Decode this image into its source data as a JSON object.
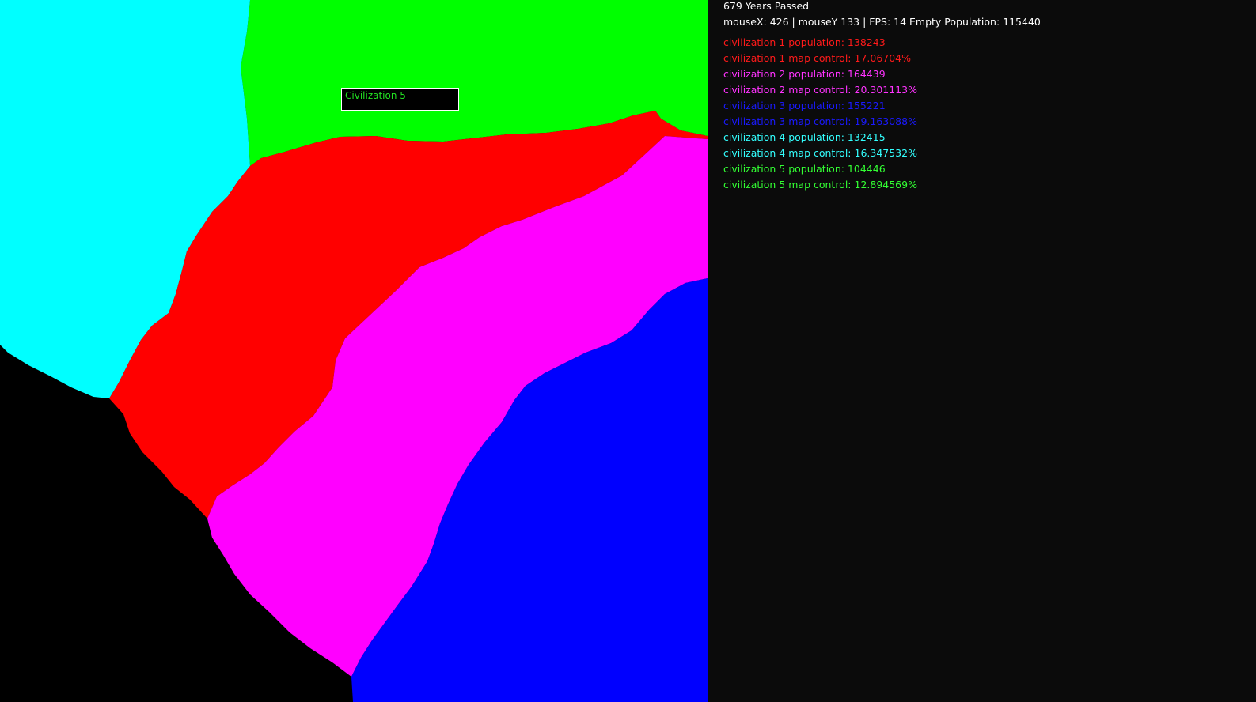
{
  "game": {
    "years_passed": "679 Years Passed",
    "debug": "mouseX: 426 | mouseY 133 | FPS: 14 Empty Population: 115440"
  },
  "hover_tooltip": {
    "label": "Civilization 5",
    "color": "#22e022"
  },
  "map_colors": {
    "empty": "#000000",
    "civ1": "#ff0000",
    "civ2": "#ff00ff",
    "civ3": "#0000ff",
    "civ4": "#00ffff",
    "civ5": "#00ff00"
  },
  "civilizations": [
    {
      "population": "civilization 1 population: 138243",
      "map_control": "civilization 1 map control: 17.06704%",
      "color": "#ff1a1a"
    },
    {
      "population": "civilization 2 population: 164439",
      "map_control": "civilization 2 map control: 20.301113%",
      "color": "#ff33ff"
    },
    {
      "population": "civilization 3 population: 155221",
      "map_control": "civilization 3 map control: 19.163088%",
      "color": "#1a1aff"
    },
    {
      "population": "civilization 4 population: 132415",
      "map_control": "civilization 4 map control: 16.347532%",
      "color": "#33ffff"
    },
    {
      "population": "civilization 5 population: 104446",
      "map_control": "civilization 5 map control: 12.894569%",
      "color": "#33ff33"
    }
  ]
}
